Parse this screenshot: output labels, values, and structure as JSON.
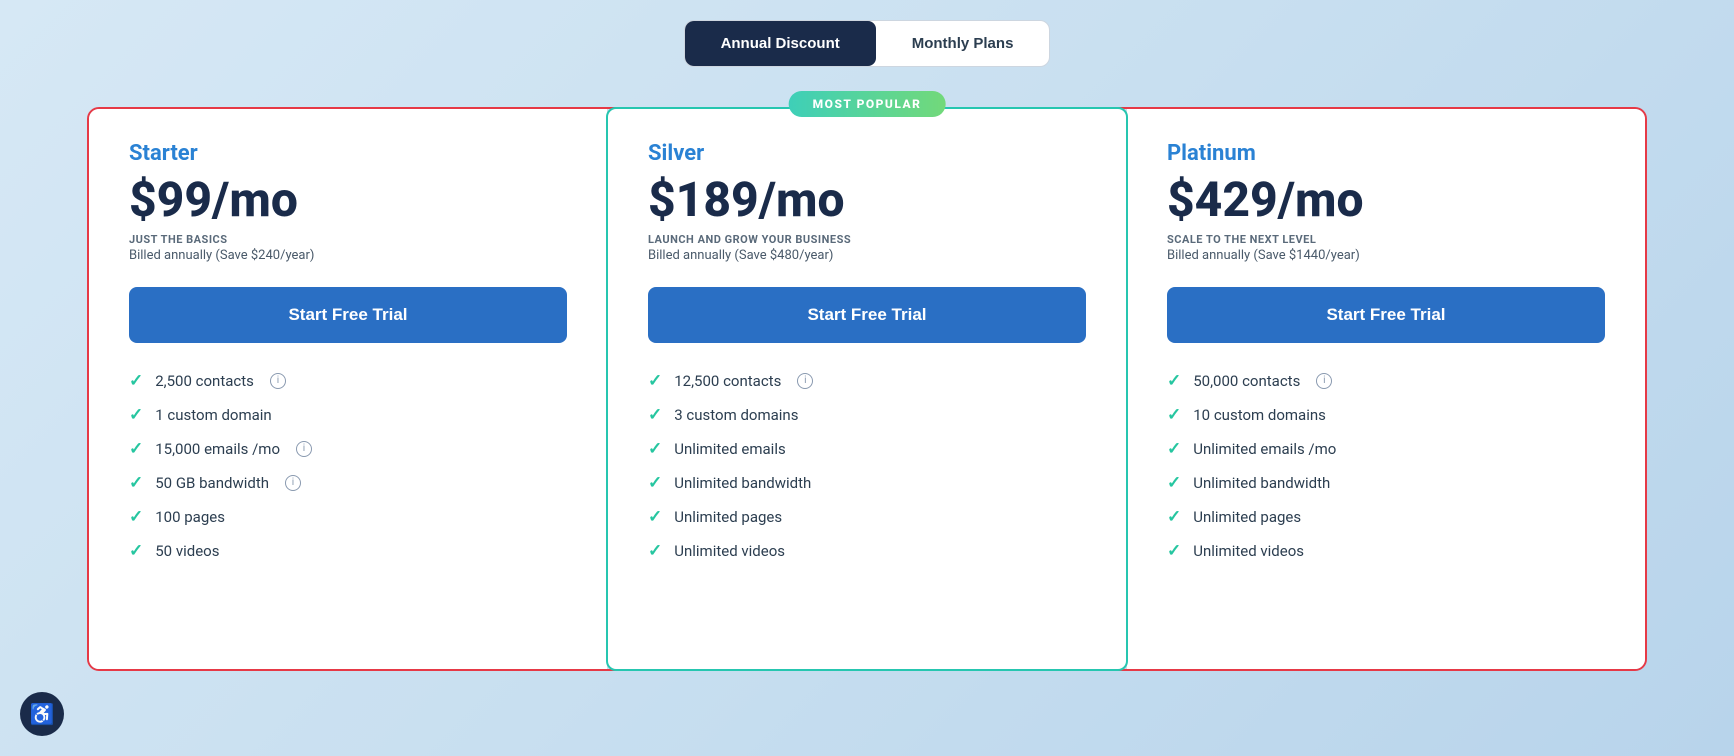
{
  "toggle": {
    "annual_label": "Annual Discount",
    "monthly_label": "Monthly Plans",
    "active": "annual"
  },
  "plans": [
    {
      "id": "starter",
      "name": "Starter",
      "price": "$99/mo",
      "tagline": "JUST THE BASICS",
      "billing": "Billed annually (Save $240/year)",
      "cta": "Start Free Trial",
      "popular": false,
      "features": [
        {
          "text": "2,500 contacts",
          "info": true
        },
        {
          "text": "1 custom domain",
          "info": false
        },
        {
          "text": "15,000 emails /mo",
          "info": true
        },
        {
          "text": "50 GB bandwidth",
          "info": true
        },
        {
          "text": "100 pages",
          "info": false
        },
        {
          "text": "50 videos",
          "info": false
        }
      ]
    },
    {
      "id": "silver",
      "name": "Silver",
      "price": "$189/mo",
      "tagline": "LAUNCH AND GROW YOUR BUSINESS",
      "billing": "Billed annually (Save $480/year)",
      "cta": "Start Free Trial",
      "popular": true,
      "popular_label": "MOST POPULAR",
      "features": [
        {
          "text": "12,500 contacts",
          "info": true
        },
        {
          "text": "3 custom domains",
          "info": false
        },
        {
          "text": "Unlimited emails",
          "info": false
        },
        {
          "text": "Unlimited bandwidth",
          "info": false
        },
        {
          "text": "Unlimited pages",
          "info": false
        },
        {
          "text": "Unlimited videos",
          "info": false
        }
      ]
    },
    {
      "id": "platinum",
      "name": "Platinum",
      "price": "$429/mo",
      "tagline": "SCALE TO THE NEXT LEVEL",
      "billing": "Billed annually (Save $1440/year)",
      "cta": "Start Free Trial",
      "popular": false,
      "features": [
        {
          "text": "50,000 contacts",
          "info": true
        },
        {
          "text": "10 custom domains",
          "info": false
        },
        {
          "text": "Unlimited emails /mo",
          "info": false
        },
        {
          "text": "Unlimited bandwidth",
          "info": false
        },
        {
          "text": "Unlimited pages",
          "info": false
        },
        {
          "text": "Unlimited videos",
          "info": false
        }
      ]
    }
  ],
  "accessibility": {
    "icon": "♿"
  }
}
